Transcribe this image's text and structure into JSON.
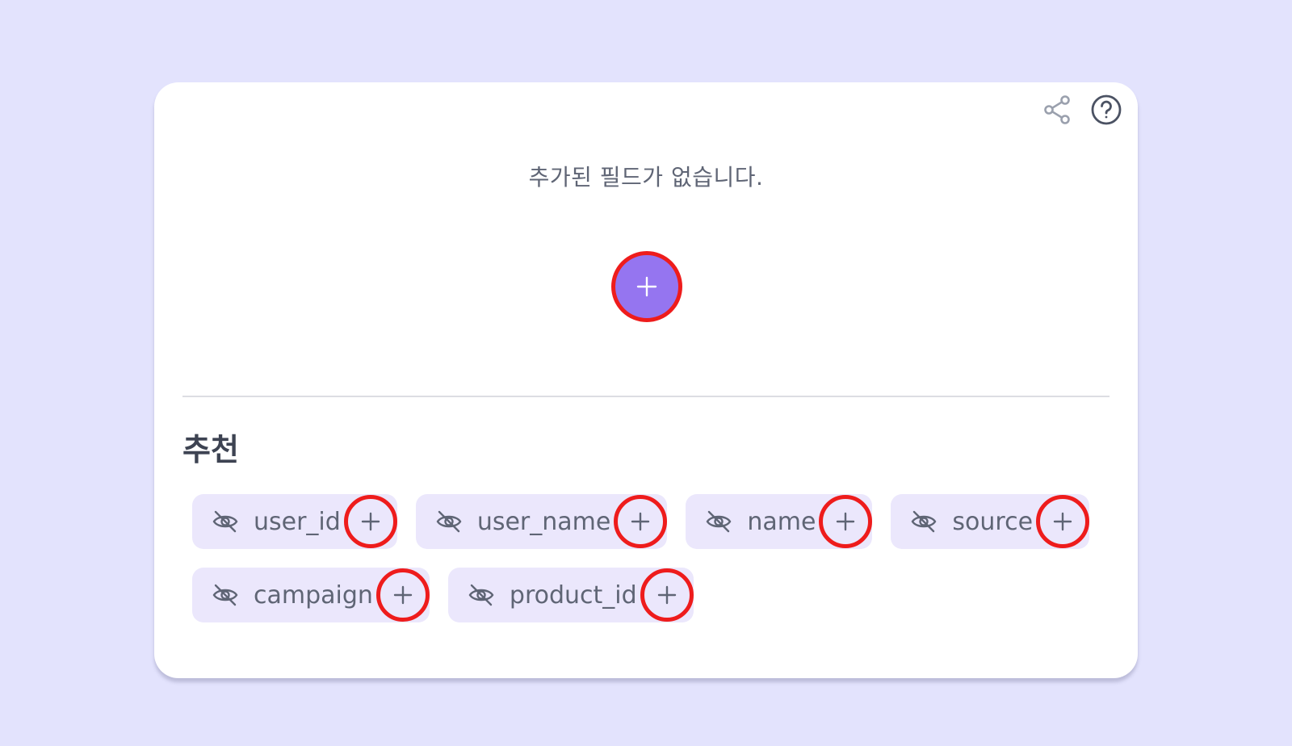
{
  "header": {
    "share_icon": "share-icon",
    "help_icon": "help-circle-icon"
  },
  "empty_state": {
    "message": "추가된 필드가 없습니다.",
    "add_button_icon": "plus-icon"
  },
  "recommendations": {
    "title": "추천",
    "chips": [
      {
        "label": "user_id",
        "icon": "eye-off-icon",
        "action_icon": "plus-icon"
      },
      {
        "label": "user_name",
        "icon": "eye-off-icon",
        "action_icon": "plus-icon"
      },
      {
        "label": "name",
        "icon": "eye-off-icon",
        "action_icon": "plus-icon"
      },
      {
        "label": "source",
        "icon": "eye-off-icon",
        "action_icon": "plus-icon"
      },
      {
        "label": "campaign",
        "icon": "eye-off-icon",
        "action_icon": "plus-icon"
      },
      {
        "label": "product_id",
        "icon": "eye-off-icon",
        "action_icon": "plus-icon"
      }
    ]
  },
  "colors": {
    "page_background": "#e3e3fd",
    "card_background": "#ffffff",
    "primary_button": "#9575f0",
    "chip_background": "#ebe7fc",
    "highlight_ring": "#ee1c1c",
    "text": "#5f6575",
    "title_text": "#3d4352"
  }
}
